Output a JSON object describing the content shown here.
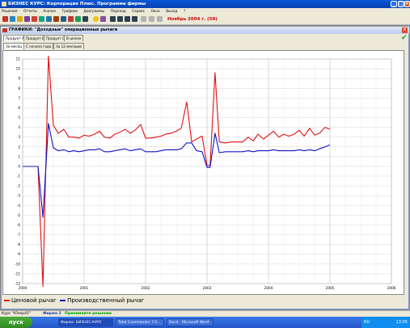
{
  "window": {
    "title": "БИЗНЕС КУРС: Корпорация Плюс. Программа фирмы",
    "controls": [
      "minimize-icon",
      "maximize-icon",
      "close-icon"
    ]
  },
  "menu": [
    "Решения",
    "Отчеты",
    "Анализ",
    "Графики",
    "Диаграммы",
    "Переход",
    "Сервис",
    "Окно",
    "Выход",
    "?"
  ],
  "toolbar": {
    "period": "Ноябрь 2004 г. (59)"
  },
  "inner_window": {
    "title": "ГРАФИКИ: \"Доходные\" операционные рычаги",
    "product_tabs": [
      "Продукт A",
      "Продукт B",
      "Продукт C",
      "В целом"
    ],
    "range_tabs": [
      "За месяц",
      "С начала года",
      "За 12 месяцев"
    ]
  },
  "legend": [
    {
      "label": "Ценовой рычаг",
      "color": "#e01010"
    },
    {
      "label": "Производственный рычаг",
      "color": "#1010c8"
    }
  ],
  "status": {
    "course": "Курс \"Юзер41\"",
    "firm": "Фирма 2",
    "action": "Принимайте решения"
  },
  "taskbar": {
    "start": "пуск",
    "tasks": [
      "Фирма: БИЗНЕС-КУРС",
      "Total Commander 7.0...",
      "Doc4 - Microsoft Word"
    ],
    "lang": "RU",
    "clock": "13:05"
  },
  "chart_data": {
    "type": "line",
    "title": "",
    "xlabel": "",
    "ylabel": "",
    "xlim": [
      2000.0,
      2006.0
    ],
    "ylim": [
      -12,
      11
    ],
    "x_ticks": [
      "2000",
      "2001",
      "2002",
      "2003",
      "2004",
      "2005",
      "2006"
    ],
    "y_ticks": [
      -12,
      -11,
      -10,
      -9,
      -8,
      -7,
      -6,
      -5,
      -4,
      -3,
      -2,
      -1,
      0,
      1,
      2,
      3,
      4,
      5,
      6,
      7,
      8,
      9,
      10,
      11
    ],
    "grid": true,
    "series": [
      {
        "name": "Ценовой рычаг",
        "color": "#e01010",
        "points": [
          [
            2000.0,
            0
          ],
          [
            2000.25,
            0
          ],
          [
            2000.33,
            -12.3
          ],
          [
            2000.42,
            11.3
          ],
          [
            2000.5,
            4.2
          ],
          [
            2000.58,
            3.4
          ],
          [
            2000.67,
            3.8
          ],
          [
            2000.75,
            3.0
          ],
          [
            2000.83,
            3.0
          ],
          [
            2000.92,
            2.9
          ],
          [
            2001.0,
            3.2
          ],
          [
            2001.08,
            3.1
          ],
          [
            2001.17,
            3.3
          ],
          [
            2001.25,
            3.6
          ],
          [
            2001.33,
            3.0
          ],
          [
            2001.42,
            2.9
          ],
          [
            2001.5,
            3.3
          ],
          [
            2001.58,
            3.5
          ],
          [
            2001.67,
            3.8
          ],
          [
            2001.75,
            3.4
          ],
          [
            2001.83,
            3.7
          ],
          [
            2001.92,
            4.3
          ],
          [
            2002.0,
            2.9
          ],
          [
            2002.08,
            2.9
          ],
          [
            2002.17,
            3.0
          ],
          [
            2002.25,
            3.1
          ],
          [
            2002.33,
            3.3
          ],
          [
            2002.42,
            3.4
          ],
          [
            2002.5,
            3.6
          ],
          [
            2002.58,
            3.9
          ],
          [
            2002.67,
            6.6
          ],
          [
            2002.75,
            2.5
          ],
          [
            2002.83,
            2.8
          ],
          [
            2002.92,
            3.1
          ],
          [
            2003.0,
            0.1
          ],
          [
            2003.05,
            0.1
          ],
          [
            2003.13,
            9.6
          ],
          [
            2003.2,
            2.5
          ],
          [
            2003.3,
            2.4
          ],
          [
            2003.4,
            2.5
          ],
          [
            2003.5,
            2.5
          ],
          [
            2003.58,
            2.5
          ],
          [
            2003.67,
            3.0
          ],
          [
            2003.75,
            2.6
          ],
          [
            2003.83,
            3.3
          ],
          [
            2003.92,
            2.8
          ],
          [
            2004.0,
            3.2
          ],
          [
            2004.08,
            3.6
          ],
          [
            2004.17,
            3.0
          ],
          [
            2004.25,
            3.3
          ],
          [
            2004.33,
            3.1
          ],
          [
            2004.42,
            3.3
          ],
          [
            2004.5,
            3.7
          ],
          [
            2004.58,
            3.1
          ],
          [
            2004.67,
            3.9
          ],
          [
            2004.75,
            3.2
          ],
          [
            2004.83,
            3.4
          ],
          [
            2004.92,
            4.0
          ],
          [
            2005.0,
            3.8
          ]
        ]
      },
      {
        "name": "Производственный рычаг",
        "color": "#1010c8",
        "points": [
          [
            2000.0,
            0
          ],
          [
            2000.25,
            0
          ],
          [
            2000.33,
            -5.2
          ],
          [
            2000.42,
            4.4
          ],
          [
            2000.5,
            1.9
          ],
          [
            2000.58,
            1.6
          ],
          [
            2000.67,
            1.7
          ],
          [
            2000.75,
            1.5
          ],
          [
            2000.83,
            1.6
          ],
          [
            2000.92,
            1.5
          ],
          [
            2001.0,
            1.6
          ],
          [
            2001.08,
            1.7
          ],
          [
            2001.17,
            1.7
          ],
          [
            2001.25,
            1.8
          ],
          [
            2001.33,
            1.5
          ],
          [
            2001.42,
            1.5
          ],
          [
            2001.5,
            1.6
          ],
          [
            2001.58,
            1.7
          ],
          [
            2001.67,
            1.8
          ],
          [
            2001.75,
            1.6
          ],
          [
            2001.83,
            1.7
          ],
          [
            2001.92,
            1.8
          ],
          [
            2002.0,
            1.5
          ],
          [
            2002.08,
            1.5
          ],
          [
            2002.17,
            1.5
          ],
          [
            2002.25,
            1.6
          ],
          [
            2002.33,
            1.7
          ],
          [
            2002.42,
            1.7
          ],
          [
            2002.5,
            1.7
          ],
          [
            2002.58,
            1.8
          ],
          [
            2002.67,
            2.4
          ],
          [
            2002.75,
            2.4
          ],
          [
            2002.83,
            1.6
          ],
          [
            2002.92,
            1.5
          ],
          [
            2003.0,
            -0.1
          ],
          [
            2003.05,
            -0.1
          ],
          [
            2003.13,
            3.4
          ],
          [
            2003.2,
            1.4
          ],
          [
            2003.3,
            1.5
          ],
          [
            2003.4,
            1.5
          ],
          [
            2003.5,
            1.5
          ],
          [
            2003.58,
            1.5
          ],
          [
            2003.67,
            1.6
          ],
          [
            2003.75,
            1.5
          ],
          [
            2003.83,
            1.6
          ],
          [
            2003.92,
            1.6
          ],
          [
            2004.0,
            1.6
          ],
          [
            2004.08,
            1.7
          ],
          [
            2004.17,
            1.6
          ],
          [
            2004.25,
            1.6
          ],
          [
            2004.33,
            1.6
          ],
          [
            2004.42,
            1.6
          ],
          [
            2004.5,
            1.7
          ],
          [
            2004.58,
            1.6
          ],
          [
            2004.67,
            1.7
          ],
          [
            2004.75,
            1.6
          ],
          [
            2004.83,
            1.8
          ],
          [
            2004.92,
            2.0
          ],
          [
            2005.0,
            2.2
          ]
        ]
      }
    ]
  }
}
